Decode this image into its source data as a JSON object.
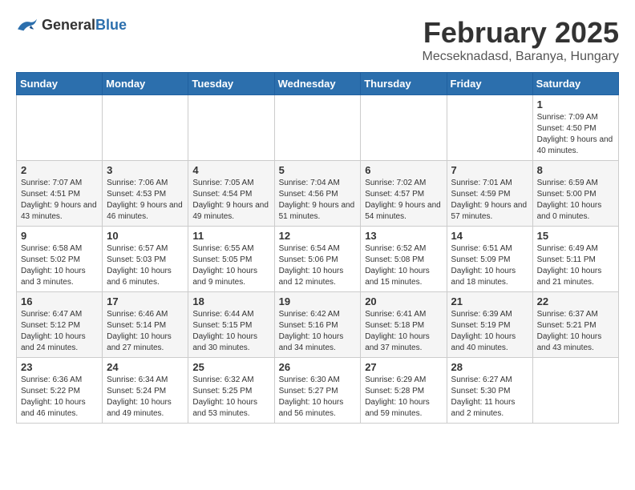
{
  "logo": {
    "general": "General",
    "blue": "Blue"
  },
  "title": "February 2025",
  "subtitle": "Mecseknadasd, Baranya, Hungary",
  "weekdays": [
    "Sunday",
    "Monday",
    "Tuesday",
    "Wednesday",
    "Thursday",
    "Friday",
    "Saturday"
  ],
  "weeks": [
    [
      {
        "day": "",
        "info": ""
      },
      {
        "day": "",
        "info": ""
      },
      {
        "day": "",
        "info": ""
      },
      {
        "day": "",
        "info": ""
      },
      {
        "day": "",
        "info": ""
      },
      {
        "day": "",
        "info": ""
      },
      {
        "day": "1",
        "info": "Sunrise: 7:09 AM\nSunset: 4:50 PM\nDaylight: 9 hours and 40 minutes."
      }
    ],
    [
      {
        "day": "2",
        "info": "Sunrise: 7:07 AM\nSunset: 4:51 PM\nDaylight: 9 hours and 43 minutes."
      },
      {
        "day": "3",
        "info": "Sunrise: 7:06 AM\nSunset: 4:53 PM\nDaylight: 9 hours and 46 minutes."
      },
      {
        "day": "4",
        "info": "Sunrise: 7:05 AM\nSunset: 4:54 PM\nDaylight: 9 hours and 49 minutes."
      },
      {
        "day": "5",
        "info": "Sunrise: 7:04 AM\nSunset: 4:56 PM\nDaylight: 9 hours and 51 minutes."
      },
      {
        "day": "6",
        "info": "Sunrise: 7:02 AM\nSunset: 4:57 PM\nDaylight: 9 hours and 54 minutes."
      },
      {
        "day": "7",
        "info": "Sunrise: 7:01 AM\nSunset: 4:59 PM\nDaylight: 9 hours and 57 minutes."
      },
      {
        "day": "8",
        "info": "Sunrise: 6:59 AM\nSunset: 5:00 PM\nDaylight: 10 hours and 0 minutes."
      }
    ],
    [
      {
        "day": "9",
        "info": "Sunrise: 6:58 AM\nSunset: 5:02 PM\nDaylight: 10 hours and 3 minutes."
      },
      {
        "day": "10",
        "info": "Sunrise: 6:57 AM\nSunset: 5:03 PM\nDaylight: 10 hours and 6 minutes."
      },
      {
        "day": "11",
        "info": "Sunrise: 6:55 AM\nSunset: 5:05 PM\nDaylight: 10 hours and 9 minutes."
      },
      {
        "day": "12",
        "info": "Sunrise: 6:54 AM\nSunset: 5:06 PM\nDaylight: 10 hours and 12 minutes."
      },
      {
        "day": "13",
        "info": "Sunrise: 6:52 AM\nSunset: 5:08 PM\nDaylight: 10 hours and 15 minutes."
      },
      {
        "day": "14",
        "info": "Sunrise: 6:51 AM\nSunset: 5:09 PM\nDaylight: 10 hours and 18 minutes."
      },
      {
        "day": "15",
        "info": "Sunrise: 6:49 AM\nSunset: 5:11 PM\nDaylight: 10 hours and 21 minutes."
      }
    ],
    [
      {
        "day": "16",
        "info": "Sunrise: 6:47 AM\nSunset: 5:12 PM\nDaylight: 10 hours and 24 minutes."
      },
      {
        "day": "17",
        "info": "Sunrise: 6:46 AM\nSunset: 5:14 PM\nDaylight: 10 hours and 27 minutes."
      },
      {
        "day": "18",
        "info": "Sunrise: 6:44 AM\nSunset: 5:15 PM\nDaylight: 10 hours and 30 minutes."
      },
      {
        "day": "19",
        "info": "Sunrise: 6:42 AM\nSunset: 5:16 PM\nDaylight: 10 hours and 34 minutes."
      },
      {
        "day": "20",
        "info": "Sunrise: 6:41 AM\nSunset: 5:18 PM\nDaylight: 10 hours and 37 minutes."
      },
      {
        "day": "21",
        "info": "Sunrise: 6:39 AM\nSunset: 5:19 PM\nDaylight: 10 hours and 40 minutes."
      },
      {
        "day": "22",
        "info": "Sunrise: 6:37 AM\nSunset: 5:21 PM\nDaylight: 10 hours and 43 minutes."
      }
    ],
    [
      {
        "day": "23",
        "info": "Sunrise: 6:36 AM\nSunset: 5:22 PM\nDaylight: 10 hours and 46 minutes."
      },
      {
        "day": "24",
        "info": "Sunrise: 6:34 AM\nSunset: 5:24 PM\nDaylight: 10 hours and 49 minutes."
      },
      {
        "day": "25",
        "info": "Sunrise: 6:32 AM\nSunset: 5:25 PM\nDaylight: 10 hours and 53 minutes."
      },
      {
        "day": "26",
        "info": "Sunrise: 6:30 AM\nSunset: 5:27 PM\nDaylight: 10 hours and 56 minutes."
      },
      {
        "day": "27",
        "info": "Sunrise: 6:29 AM\nSunset: 5:28 PM\nDaylight: 10 hours and 59 minutes."
      },
      {
        "day": "28",
        "info": "Sunrise: 6:27 AM\nSunset: 5:30 PM\nDaylight: 11 hours and 2 minutes."
      },
      {
        "day": "",
        "info": ""
      }
    ]
  ]
}
